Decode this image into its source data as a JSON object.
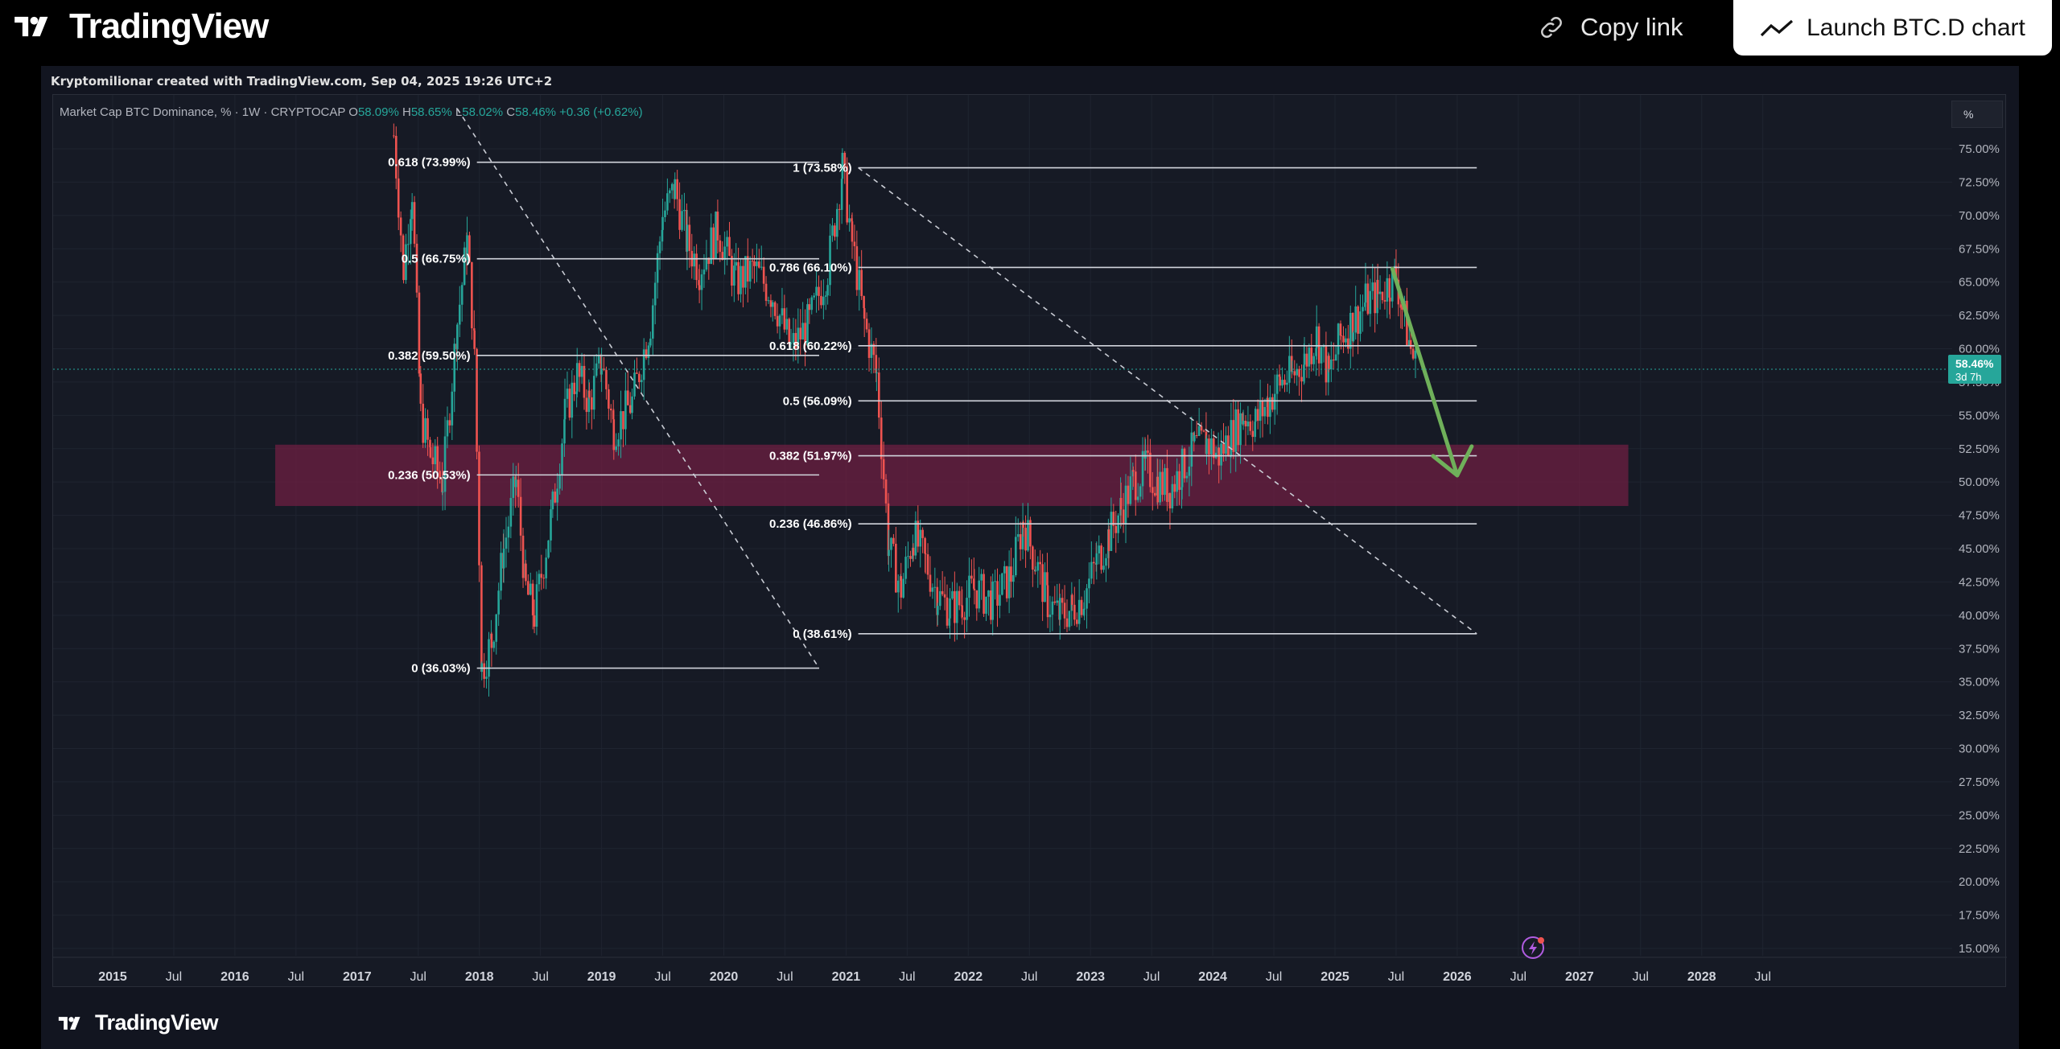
{
  "header": {
    "brand": "TradingView",
    "copy_link": "Copy link",
    "launch_button": "Launch BTC.D chart"
  },
  "chart_meta": {
    "created_by": "Kryptomilionar created with TradingView.com, Sep 04, 2025 19:26 UTC+2",
    "symbol_line": {
      "name": "Market Cap BTC Dominance, % · 1W · CRYPTOCAP",
      "open_label": "O",
      "open": "58.09%",
      "high_label": "H",
      "high": "58.65%",
      "low_label": "L",
      "low": "58.02%",
      "close_label": "C",
      "close": "58.46%",
      "change": "+0.36 (+0.62%)"
    },
    "scale_button": "%",
    "price_tag": {
      "value": "58.46%",
      "countdown": "3d 7h"
    },
    "footer_brand": "TradingView"
  },
  "colors": {
    "background": "#161a25",
    "up": "#26a69a",
    "down": "#ef5350",
    "zone": "#7b1f45",
    "arrow": "#6fb05a",
    "price_tag": "#26a69a"
  },
  "chart_data": {
    "type": "candlestick",
    "symbol": "BTC.D",
    "timeframe": "1W",
    "y_unit": "%",
    "ylim": [
      15,
      77
    ],
    "y_ticks": [
      "75.00%",
      "72.50%",
      "70.00%",
      "67.50%",
      "65.00%",
      "62.50%",
      "60.00%",
      "57.50%",
      "55.00%",
      "52.50%",
      "50.00%",
      "47.50%",
      "45.00%",
      "42.50%",
      "40.00%",
      "37.50%",
      "35.00%",
      "32.50%",
      "30.00%",
      "27.50%",
      "25.00%",
      "22.50%",
      "20.00%",
      "17.50%",
      "15.00%"
    ],
    "x_ticks": [
      "2015",
      "Jul",
      "2016",
      "Jul",
      "2017",
      "Jul",
      "2018",
      "Jul",
      "2019",
      "Jul",
      "2020",
      "Jul",
      "2021",
      "Jul",
      "2022",
      "Jul",
      "2023",
      "Jul",
      "2024",
      "Jul",
      "2025",
      "Jul",
      "2026",
      "Jul",
      "2027",
      "Jul",
      "2028",
      "Jul"
    ],
    "x_tick_dates": [
      2015.0,
      2015.5,
      2016.0,
      2016.5,
      2017.0,
      2017.5,
      2018.0,
      2018.5,
      2019.0,
      2019.5,
      2020.0,
      2020.5,
      2021.0,
      2021.5,
      2022.0,
      2022.5,
      2023.0,
      2023.5,
      2024.0,
      2024.5,
      2025.0,
      2025.5,
      2026.0,
      2026.5,
      2027.0,
      2027.5,
      2028.0,
      2028.5
    ],
    "xlim": [
      2014.62,
      2028.72
    ],
    "price_path": [
      [
        2017.3,
        76.0
      ],
      [
        2017.38,
        66.0
      ],
      [
        2017.45,
        72.0
      ],
      [
        2017.52,
        55.0
      ],
      [
        2017.6,
        52.0
      ],
      [
        2017.7,
        50.0
      ],
      [
        2017.82,
        62.0
      ],
      [
        2017.9,
        68.0
      ],
      [
        2017.96,
        60.0
      ],
      [
        2018.02,
        36.0
      ],
      [
        2018.1,
        38.0
      ],
      [
        2018.2,
        45.0
      ],
      [
        2018.3,
        50.0
      ],
      [
        2018.38,
        42.0
      ],
      [
        2018.45,
        40.0
      ],
      [
        2018.6,
        48.0
      ],
      [
        2018.7,
        55.0
      ],
      [
        2018.8,
        58.0
      ],
      [
        2018.9,
        56.0
      ],
      [
        2019.0,
        59.0
      ],
      [
        2019.1,
        54.0
      ],
      [
        2019.25,
        56.0
      ],
      [
        2019.4,
        62.0
      ],
      [
        2019.5,
        70.0
      ],
      [
        2019.6,
        72.0
      ],
      [
        2019.7,
        68.0
      ],
      [
        2019.8,
        66.0
      ],
      [
        2019.95,
        69.0
      ],
      [
        2020.1,
        65.0
      ],
      [
        2020.25,
        66.0
      ],
      [
        2020.4,
        64.0
      ],
      [
        2020.55,
        60.0
      ],
      [
        2020.7,
        62.0
      ],
      [
        2020.85,
        66.0
      ],
      [
        2020.97,
        73.5
      ],
      [
        2021.05,
        68.0
      ],
      [
        2021.15,
        62.0
      ],
      [
        2021.25,
        58.0
      ],
      [
        2021.35,
        45.0
      ],
      [
        2021.45,
        42.0
      ],
      [
        2021.55,
        46.0
      ],
      [
        2021.65,
        44.0
      ],
      [
        2021.75,
        41.5
      ],
      [
        2021.85,
        40.5
      ],
      [
        2021.95,
        41.0
      ],
      [
        2022.05,
        42.0
      ],
      [
        2022.2,
        41.0
      ],
      [
        2022.35,
        43.0
      ],
      [
        2022.45,
        47.0
      ],
      [
        2022.55,
        44.0
      ],
      [
        2022.65,
        41.0
      ],
      [
        2022.75,
        40.0
      ],
      [
        2022.85,
        40.5
      ],
      [
        2022.95,
        41.5
      ],
      [
        2023.05,
        44.0
      ],
      [
        2023.15,
        46.0
      ],
      [
        2023.25,
        48.0
      ],
      [
        2023.35,
        50.0
      ],
      [
        2023.45,
        51.0
      ],
      [
        2023.55,
        50.0
      ],
      [
        2023.65,
        49.5
      ],
      [
        2023.75,
        51.0
      ],
      [
        2023.85,
        52.5
      ],
      [
        2023.95,
        53.0
      ],
      [
        2024.05,
        52.0
      ],
      [
        2024.15,
        53.5
      ],
      [
        2024.25,
        55.0
      ],
      [
        2024.35,
        54.5
      ],
      [
        2024.45,
        56.0
      ],
      [
        2024.55,
        57.5
      ],
      [
        2024.65,
        58.0
      ],
      [
        2024.75,
        59.0
      ],
      [
        2024.85,
        61.0
      ],
      [
        2024.95,
        58.0
      ],
      [
        2025.05,
        61.0
      ],
      [
        2025.15,
        62.0
      ],
      [
        2025.25,
        63.5
      ],
      [
        2025.35,
        64.0
      ],
      [
        2025.45,
        65.0
      ],
      [
        2025.5,
        65.5
      ],
      [
        2025.55,
        63.0
      ],
      [
        2025.62,
        60.0
      ],
      [
        2025.67,
        58.46
      ]
    ],
    "fib_left": {
      "levels": [
        {
          "ratio": "0.618",
          "value": 73.99,
          "label": "0.618 (73.99%)"
        },
        {
          "ratio": "0.5",
          "value": 66.75,
          "label": "0.5 (66.75%)"
        },
        {
          "ratio": "0.382",
          "value": 59.5,
          "label": "0.382 (59.50%)"
        },
        {
          "ratio": "0.236",
          "value": 50.53,
          "label": "0.236 (50.53%)"
        },
        {
          "ratio": "0",
          "value": 36.03,
          "label": "0 (36.03%)"
        }
      ],
      "x_from": 2017.98,
      "x_to": 2020.78
    },
    "fib_right": {
      "levels": [
        {
          "ratio": "1",
          "value": 73.58,
          "label": "1 (73.58%)"
        },
        {
          "ratio": "0.786",
          "value": 66.1,
          "label": "0.786 (66.10%)"
        },
        {
          "ratio": "0.618",
          "value": 60.22,
          "label": "0.618 (60.22%)"
        },
        {
          "ratio": "0.5",
          "value": 56.09,
          "label": "0.5 (56.09%)"
        },
        {
          "ratio": "0.382",
          "value": 51.97,
          "label": "0.382 (51.97%)"
        },
        {
          "ratio": "0.236",
          "value": 46.86,
          "label": "0.236 (46.86%)"
        },
        {
          "ratio": "0",
          "value": 38.61,
          "label": "0 (38.61%)"
        }
      ],
      "x_from": 2021.1,
      "x_to": 2026.16
    },
    "zone": {
      "x_from": 2016.33,
      "x_to": 2027.4,
      "y_from": 48.2,
      "y_to": 52.8
    },
    "trendlines": [
      {
        "from": [
          2017.82,
          78.0
        ],
        "to": [
          2020.78,
          36.03
        ],
        "style": "dashed"
      },
      {
        "from": [
          2021.1,
          73.58
        ],
        "to": [
          2026.16,
          38.61
        ],
        "style": "dashed"
      }
    ],
    "projection_arrow": {
      "from": [
        2025.47,
        66.0
      ],
      "to": [
        2026.0,
        50.5
      ]
    },
    "current_price": 58.46
  }
}
